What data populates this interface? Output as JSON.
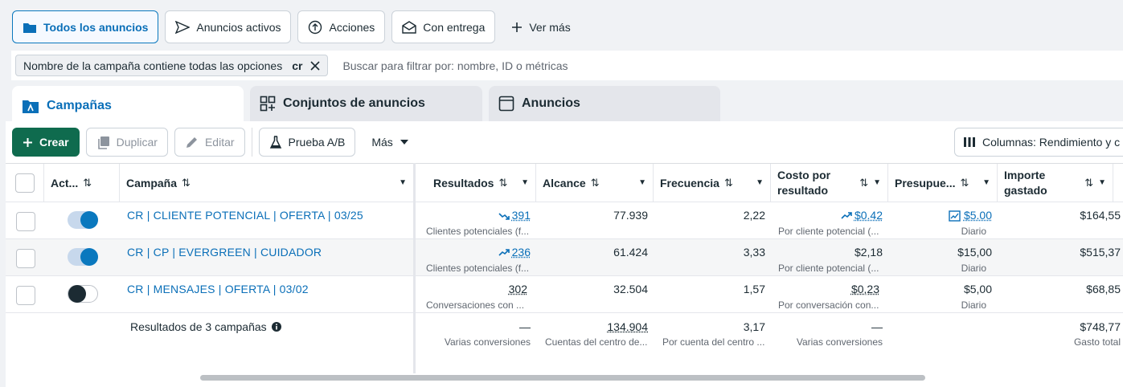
{
  "filters": {
    "chips": [
      {
        "label": "Todos los anuncios",
        "icon": "folder-icon",
        "active": true
      },
      {
        "label": "Anuncios activos",
        "icon": "send-icon"
      },
      {
        "label": "Acciones",
        "icon": "upload-circle-icon"
      },
      {
        "label": "Con entrega",
        "icon": "envelope-icon"
      },
      {
        "label": "Ver más",
        "icon": "plus-icon"
      }
    ]
  },
  "filterbar": {
    "tag_label": "Nombre de la campaña contiene todas las opciones",
    "tag_value": "cr",
    "search_placeholder": "Buscar para filtrar por: nombre, ID o métricas"
  },
  "tabs": [
    {
      "label": "Campañas",
      "icon": "campaign-folder-icon"
    },
    {
      "label": "Conjuntos de anuncios",
      "icon": "grid-icon"
    },
    {
      "label": "Anuncios",
      "icon": "ad-window-icon"
    }
  ],
  "toolbar": {
    "create": "Crear",
    "duplicate": "Duplicar",
    "edit": "Editar",
    "abtest": "Prueba A/B",
    "more": "Más",
    "columns": "Columnas: Rendimiento y c"
  },
  "table": {
    "headers": {
      "active": "Act...",
      "campaign": "Campaña",
      "results": "Resultados",
      "reach": "Alcance",
      "frequency": "Frecuencia",
      "cpr_line1": "Costo por",
      "cpr_line2": "resultado",
      "budget": "Presupue...",
      "spent_line1": "Importe",
      "spent_line2": "gastado"
    },
    "rows": [
      {
        "campaign": "CR | CLIENTE POTENCIAL | OFERTA | 03/25",
        "active": true,
        "results": "391",
        "results_sub": "Clientes potenciales (f...",
        "reach": "77.939",
        "frequency": "2,22",
        "cpr": "$0.42",
        "cpr_sub": "Por cliente potencial (...",
        "budget": "$5.00",
        "budget_sub": "Diario",
        "spent": "$164,55"
      },
      {
        "campaign": "CR | CP | EVERGREEN | CUIDADOR",
        "active": true,
        "results": "236",
        "results_sub": "Clientes potenciales (f...",
        "reach": "61.424",
        "frequency": "3,33",
        "cpr": "$2,18",
        "cpr_sub": "Por cliente potencial (...",
        "budget": "$15,00",
        "budget_sub": "Diario",
        "spent": "$515,37"
      },
      {
        "campaign": "CR | MENSAJES | OFERTA | 03/02",
        "active": false,
        "results": "302",
        "results_sub": "Conversaciones con ...",
        "reach": "32.504",
        "frequency": "1,57",
        "cpr": "$0,23",
        "cpr_sub": "Por conversación con...",
        "budget": "$5,00",
        "budget_sub": "Diario",
        "spent": "$68,85"
      }
    ],
    "totals": {
      "label": "Resultados de 3 campañas",
      "results": "—",
      "results_sub": "Varias conversiones",
      "reach": "134.904",
      "reach_sub": "Cuentas del centro de...",
      "frequency": "3,17",
      "frequency_sub": "Por cuenta del centro ...",
      "cpr": "—",
      "cpr_sub": "Varias conversiones",
      "spent": "$748,77",
      "spent_sub": "Gasto total"
    }
  },
  "colors": {
    "accent": "#0a78be",
    "primary_button": "#0f6b4e"
  }
}
